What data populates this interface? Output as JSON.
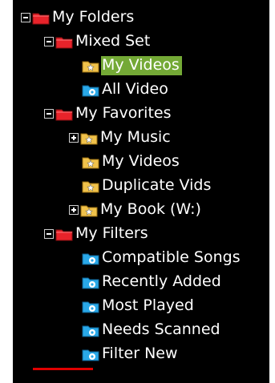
{
  "colors": {
    "background": "#000000",
    "text": "#ffffff",
    "selection": "#74a936",
    "red_folder": "#e8232a",
    "gold_folder": "#f0c24b",
    "blue_folder": "#29a8e8",
    "red_line": "#e00000"
  },
  "tree": {
    "root": {
      "label": "My Folders",
      "icon": "red-folder-icon",
      "expanded": true
    },
    "mixed_set": {
      "label": "Mixed Set",
      "icon": "red-folder-icon",
      "expanded": true,
      "items": [
        {
          "label": "My Videos",
          "icon": "gold-star-folder-icon",
          "selected": true
        },
        {
          "label": "All Video",
          "icon": "blue-gear-folder-icon"
        }
      ]
    },
    "favorites": {
      "label": "My Favorites",
      "icon": "red-folder-icon",
      "expanded": true,
      "items": [
        {
          "label": "My Music",
          "icon": "gold-star-folder-icon",
          "collapsed": true
        },
        {
          "label": "My Videos",
          "icon": "gold-star-folder-icon"
        },
        {
          "label": "Duplicate Vids",
          "icon": "gold-star-folder-icon"
        },
        {
          "label": "My Book (W:)",
          "icon": "gold-star-folder-icon",
          "collapsed": true
        }
      ]
    },
    "filters": {
      "label": "My Filters",
      "icon": "red-folder-icon",
      "expanded": true,
      "items": [
        {
          "label": "Compatible Songs",
          "icon": "blue-gear-folder-icon"
        },
        {
          "label": "Recently Added",
          "icon": "blue-gear-folder-icon"
        },
        {
          "label": "Most Played",
          "icon": "blue-gear-folder-icon"
        },
        {
          "label": "Needs Scanned",
          "icon": "blue-gear-folder-icon"
        },
        {
          "label": "Filter New",
          "icon": "blue-gear-folder-icon"
        }
      ]
    }
  }
}
